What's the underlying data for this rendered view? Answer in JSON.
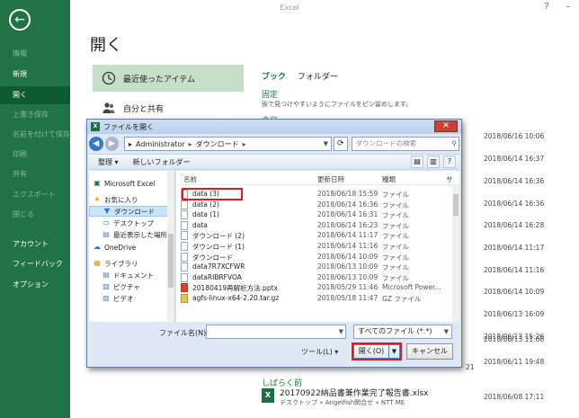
{
  "app": {
    "title": "Excel"
  },
  "nav": {
    "back_glyph": "←",
    "items": [
      {
        "label": "情報",
        "state": "dim"
      },
      {
        "label": "新規",
        "state": "normal"
      },
      {
        "label": "開く",
        "state": "active"
      },
      {
        "label": "上書き保存",
        "state": "dim"
      },
      {
        "label": "名前を付けて保存",
        "state": "dim"
      },
      {
        "label": "印刷",
        "state": "dim"
      },
      {
        "label": "共有",
        "state": "dim"
      },
      {
        "label": "エクスポート",
        "state": "dim"
      },
      {
        "label": "閉じる",
        "state": "dim"
      },
      {
        "label": "アカウント",
        "state": "normal"
      },
      {
        "label": "フィードバック",
        "state": "normal"
      },
      {
        "label": "オプション",
        "state": "normal"
      }
    ]
  },
  "page": {
    "heading": "開く",
    "places": [
      {
        "label": "最近使ったアイテム",
        "icon": "clock-icon"
      },
      {
        "label": "自分と共有",
        "icon": "shared-people-icon"
      }
    ],
    "tabs": [
      "ブック",
      "フォルダー"
    ],
    "pinned_title": "固定",
    "pinned_desc": "後で見つけやすいようにファイルをピン留めします。",
    "today_title": "今日",
    "recent_dates": [
      "2018/06/16 10:06",
      "2018/06/14 16:37",
      "2018/06/14 16:36",
      "2018/06/14 16:36",
      "2018/06/14 16:28",
      "2018/06/14 11:17",
      "2018/06/14 11:16",
      "2018/06/14 10:09",
      "2018/06/13 16:09",
      "2018/06/13 15:26",
      "2018/06/13 11:06",
      "2018/06/11 19:48"
    ],
    "older_title": "しばらく前",
    "older_file": {
      "name": "20170922納品書兼作業完了報告書.xlsx",
      "path": "デスクトップ » Angelfish関合せ » NTT ME",
      "date": "2018/06/08 17:11"
    }
  },
  "dialog": {
    "title": "ファイルを開く",
    "close_glyph": "✕",
    "breadcrumb": [
      "Administrator",
      "ダウンロード"
    ],
    "search_placeholder": "ダウンロードの検索",
    "toolbar": {
      "organize": "整理 ▾",
      "new_folder": "新しいフォルダー"
    },
    "tree": [
      {
        "label": "Microsoft Excel",
        "icon": "excel-icon",
        "selected": false
      },
      {
        "label": "お気に入り",
        "icon": "star-icon",
        "selected": false
      },
      {
        "label": "ダウンロード",
        "icon": "download-folder-icon",
        "selected": true
      },
      {
        "label": "デスクトップ",
        "icon": "desktop-icon",
        "selected": false
      },
      {
        "label": "最近表示した場所",
        "icon": "recent-places-icon",
        "selected": false
      },
      {
        "label": "OneDrive",
        "icon": "cloud-icon",
        "selected": false
      },
      {
        "label": "ライブラリ",
        "icon": "library-icon",
        "selected": false
      },
      {
        "label": "ドキュメント",
        "icon": "documents-icon",
        "selected": false
      },
      {
        "label": "ピクチャ",
        "icon": "pictures-icon",
        "selected": false
      },
      {
        "label": "ビデオ",
        "icon": "videos-icon",
        "selected": false
      }
    ],
    "columns": {
      "name": "名前",
      "date": "更新日時",
      "type": "種類",
      "size": "サ"
    },
    "files": [
      {
        "name": "data (3)",
        "date": "2018/06/18 15:59",
        "type": "ファイル",
        "kind": "file"
      },
      {
        "name": "data (2)",
        "date": "2018/06/14 16:36",
        "type": "ファイル",
        "kind": "file"
      },
      {
        "name": "data (1)",
        "date": "2018/06/14 16:31",
        "type": "ファイル",
        "kind": "file"
      },
      {
        "name": "data",
        "date": "2018/06/14 16:23",
        "type": "ファイル",
        "kind": "file"
      },
      {
        "name": "ダウンロード (2)",
        "date": "2018/06/14 11:17",
        "type": "ファイル",
        "kind": "file"
      },
      {
        "name": "ダウンロード (1)",
        "date": "2018/06/14 11:16",
        "type": "ファイル",
        "kind": "file"
      },
      {
        "name": "ダウンロード",
        "date": "2018/06/14 10:09",
        "type": "ファイル",
        "kind": "file"
      },
      {
        "name": "data7R7XCFWR",
        "date": "2018/06/13 10:09",
        "type": "ファイル",
        "kind": "file"
      },
      {
        "name": "dataRIBRFVOA",
        "date": "2018/06/13 10:09",
        "type": "ファイル",
        "kind": "file"
      },
      {
        "name": "20180419再解析方法.pptx",
        "date": "2018/05/29 11:46",
        "type": "Microsoft Power...",
        "kind": "ppt"
      },
      {
        "name": "agfs-linux-x64-2.20.tar.gz",
        "date": "2018/05/18 11:47",
        "type": "GZ ファイル",
        "kind": "gz"
      }
    ],
    "filename_label": "ファイル名(N):",
    "filename_value": "",
    "filter": "すべてのファイル (*.*)",
    "tools_label": "ツール(L)",
    "open_label": "開く(O)",
    "cancel_label": "キャンセル",
    "side_number": "21"
  }
}
